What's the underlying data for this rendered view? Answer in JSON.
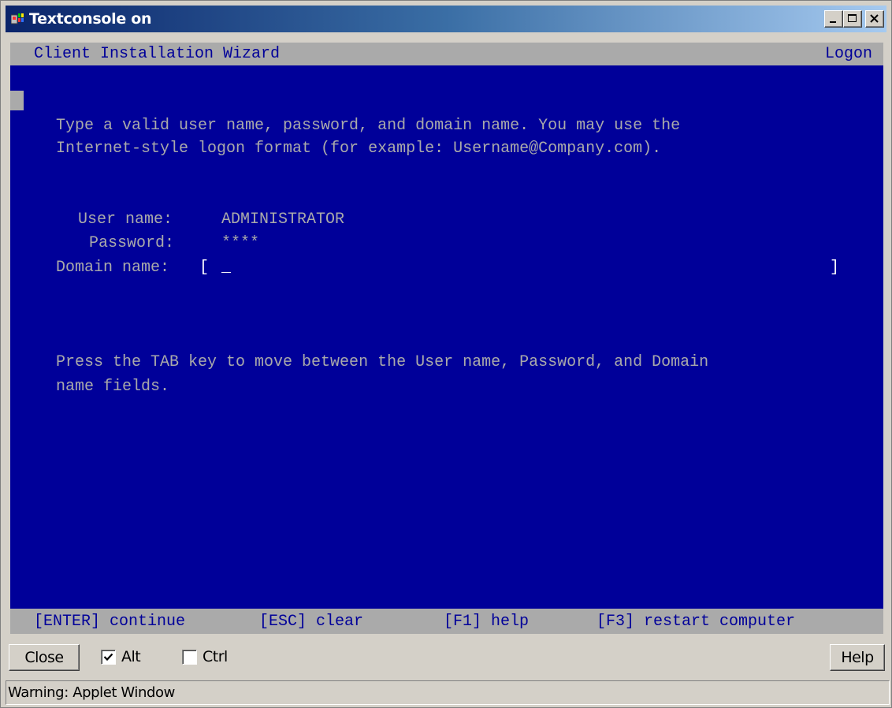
{
  "window": {
    "title": "Textconsole on"
  },
  "console": {
    "header_title": "Client Installation Wizard",
    "header_right": "Logon",
    "instructions": [
      "Type a valid user name, password, and domain name. You may use the",
      "Internet-style logon format (for example: Username@Company.com)."
    ],
    "fields": {
      "user_name_label": "User name:",
      "user_name_value": "ADMINISTRATOR",
      "password_label": "Password:",
      "password_value": "****",
      "domain_label": "Domain name:",
      "domain_open_bracket": "[",
      "domain_value": "_",
      "domain_close_bracket": "]"
    },
    "help_text": [
      "Press the TAB key to move between the User name, Password, and Domain",
      "name fields."
    ],
    "footer_keys": [
      "[ENTER] continue",
      "[ESC] clear",
      "[F1] help",
      "[F3] restart computer"
    ],
    "colors": {
      "background": "#000099",
      "text": "#aaaaaa",
      "bars": "#aaaaaa",
      "highlight": "#ffffff"
    }
  },
  "controls": {
    "close_label": "Close",
    "alt_label": "Alt",
    "alt_checked": true,
    "ctrl_label": "Ctrl",
    "ctrl_checked": false,
    "help_label": "Help"
  },
  "status": {
    "text": "Warning: Applet Window"
  }
}
